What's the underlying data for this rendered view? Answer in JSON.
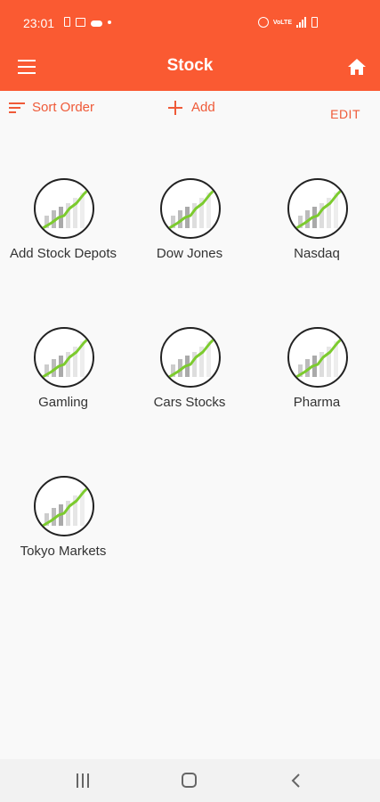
{
  "status_bar": {
    "time": "23:01",
    "volte": "VoLTE"
  },
  "app_bar": {
    "title": "Stock",
    "menu_icon": "hamburger-menu-icon",
    "home_icon": "home-icon"
  },
  "toolbar": {
    "sort_label": "Sort Order",
    "add_label": "Add",
    "edit_label": "EDIT"
  },
  "depots": [
    {
      "label": "Add Stock Depots",
      "icon": "stock-chart-icon"
    },
    {
      "label": "Dow Jones",
      "icon": "stock-chart-icon"
    },
    {
      "label": "Nasdaq",
      "icon": "stock-chart-icon"
    },
    {
      "label": "Gamling",
      "icon": "stock-chart-icon"
    },
    {
      "label": "Cars Stocks",
      "icon": "stock-chart-icon"
    },
    {
      "label": "Pharma",
      "icon": "stock-chart-icon"
    },
    {
      "label": "Tokyo Markets",
      "icon": "stock-chart-icon"
    }
  ],
  "colors": {
    "accent": "#fa5a32",
    "accent_text": "#ef5a38",
    "chart_line": "#7ccb2e"
  }
}
